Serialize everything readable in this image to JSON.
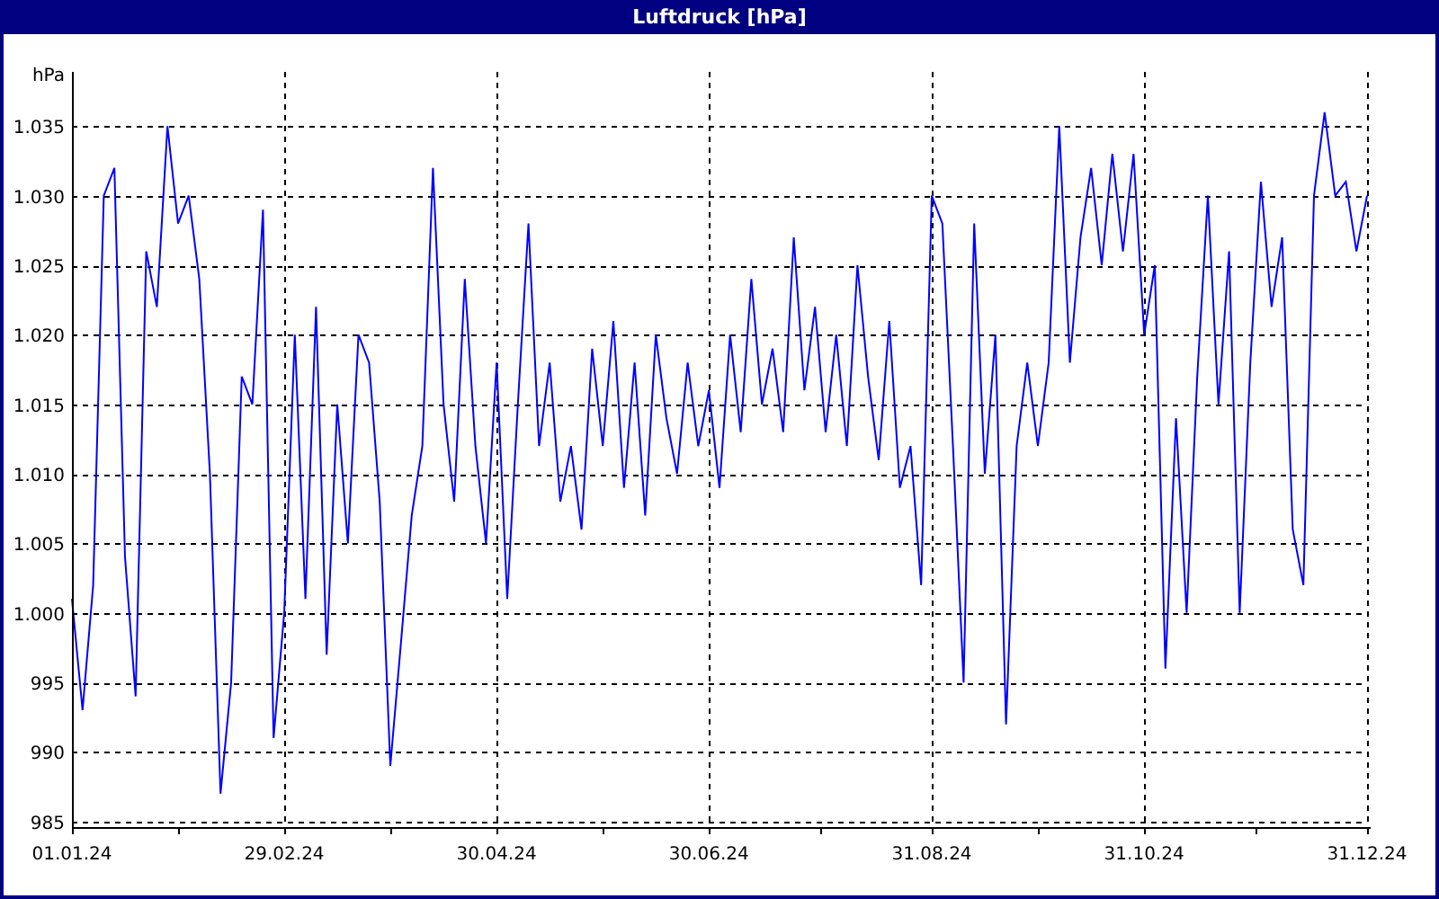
{
  "window": {
    "title": "Luftdruck [hPa]"
  },
  "chart": {
    "chart_data": {
      "type": "line",
      "ylabel": "hPa",
      "categories": [
        "01.01.24",
        null,
        null,
        null,
        null,
        null,
        null,
        null,
        null,
        null,
        null,
        null,
        null,
        null,
        null,
        null,
        null,
        null,
        null,
        null,
        "29.02.24",
        null,
        null,
        null,
        null,
        null,
        null,
        null,
        null,
        null,
        null,
        null,
        null,
        null,
        null,
        null,
        null,
        null,
        null,
        null,
        "30.04.24",
        null,
        null,
        null,
        null,
        null,
        null,
        null,
        null,
        null,
        null,
        null,
        null,
        null,
        null,
        null,
        null,
        null,
        null,
        null,
        "30.06.24",
        null,
        null,
        null,
        null,
        null,
        null,
        null,
        null,
        null,
        null,
        null,
        null,
        null,
        null,
        null,
        null,
        null,
        null,
        null,
        null,
        "31.08.24",
        null,
        null,
        null,
        null,
        null,
        null,
        null,
        null,
        null,
        null,
        null,
        null,
        null,
        null,
        null,
        null,
        null,
        null,
        null,
        "31.10.24",
        null,
        null,
        null,
        null,
        null,
        null,
        null,
        null,
        null,
        null,
        null,
        null,
        null,
        null,
        null,
        null,
        null,
        null,
        null,
        null,
        "31.12.24"
      ],
      "series": [
        {
          "color": "#0000ff",
          "values": [
            1001,
            993,
            1002,
            1030,
            1032,
            1004,
            994,
            1026,
            1022,
            1035,
            1028,
            1030,
            1024,
            1010,
            987,
            995,
            1017,
            1015,
            1029,
            991,
            1000,
            1020,
            1001,
            1022,
            997,
            1015,
            1005,
            1020,
            1018,
            1008,
            989,
            998,
            1007,
            1012,
            1032,
            1015,
            1008,
            1024,
            1012,
            1005,
            1018,
            1001,
            1015,
            1028,
            1012,
            1018,
            1008,
            1012,
            1006,
            1019,
            1012,
            1021,
            1009,
            1018,
            1007,
            1020,
            1014,
            1010,
            1018,
            1012,
            1016,
            1009,
            1020,
            1013,
            1024,
            1015,
            1019,
            1013,
            1027,
            1016,
            1022,
            1013,
            1020,
            1012,
            1025,
            1017,
            1011,
            1021,
            1009,
            1012,
            1002,
            1030,
            1028,
            1012,
            995,
            1028,
            1010,
            1020,
            992,
            1012,
            1018,
            1012,
            1018,
            1035,
            1018,
            1027,
            1032,
            1025,
            1033,
            1026,
            1033,
            1020,
            1025,
            996,
            1014,
            1000,
            1017,
            1030,
            1015,
            1026,
            1000,
            1018,
            1031,
            1022,
            1027,
            1006,
            1002,
            1030,
            1036,
            1030,
            1031,
            1026,
            1030
          ]
        }
      ],
      "grid": true,
      "ylim": [
        984.6,
        1038.9
      ],
      "yticks": [
        {
          "value": 985,
          "label": "985"
        },
        {
          "value": 990,
          "label": "990"
        },
        {
          "value": 995,
          "label": "995"
        },
        {
          "value": 1000,
          "label": "1.000"
        },
        {
          "value": 1005,
          "label": "1.005"
        },
        {
          "value": 1010,
          "label": "1.010"
        },
        {
          "value": 1015,
          "label": "1.015"
        },
        {
          "value": 1020,
          "label": "1.020"
        },
        {
          "value": 1025,
          "label": "1.025"
        },
        {
          "value": 1030,
          "label": "1.030"
        },
        {
          "value": 1035,
          "label": "1.035"
        }
      ]
    }
  }
}
